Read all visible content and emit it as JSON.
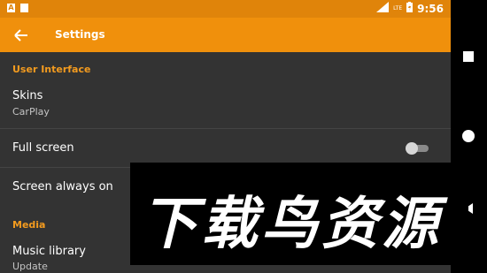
{
  "statusbar": {
    "left_icon_1": "A",
    "network": "LTE",
    "time": "9:56",
    "icons": [
      "a-notification-icon",
      "sd-card-icon",
      "lte-signal-icon",
      "battery-charging-icon"
    ]
  },
  "toolbar": {
    "title": "Settings",
    "back_icon": "arrow-left-icon"
  },
  "sections": {
    "user_interface": "User Interface",
    "media": "Media"
  },
  "items": {
    "skins": {
      "title": "Skins",
      "summary": "CarPlay"
    },
    "full_screen": {
      "title": "Full screen",
      "enabled": false
    },
    "screen_always_on": {
      "title": "Screen always on"
    },
    "music_library": {
      "title": "Music library",
      "summary": "Update"
    }
  },
  "watermark": {
    "text": "下载鸟资源"
  },
  "colors": {
    "statusbar": "#e0840a",
    "toolbar": "#f0900c",
    "accent": "#f39b1f",
    "background": "#333333"
  }
}
